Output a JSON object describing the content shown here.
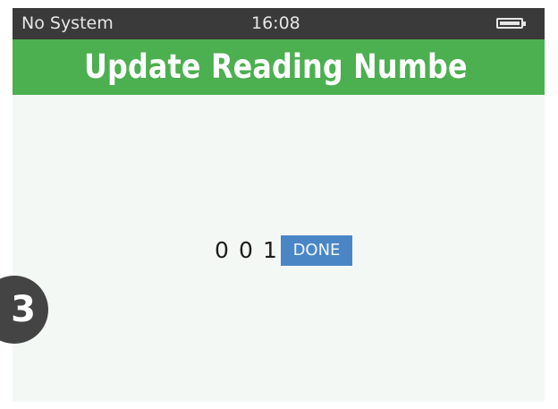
{
  "status_bar": {
    "system": "No System",
    "time": "16:08",
    "battery_icon": "battery-full-icon"
  },
  "header": {
    "title": "Update Reading Numbe"
  },
  "reading_entry": {
    "digits": [
      "0",
      "0",
      "1"
    ],
    "done_label": "DONE"
  },
  "step_badge": {
    "number": "3"
  },
  "colors": {
    "status_bar_bg": "#3a3a3a",
    "title_bar_bg": "#4caf50",
    "screen_bg": "#f4f8f5",
    "done_button_bg": "#4a86c5",
    "badge_bg": "#444444"
  }
}
